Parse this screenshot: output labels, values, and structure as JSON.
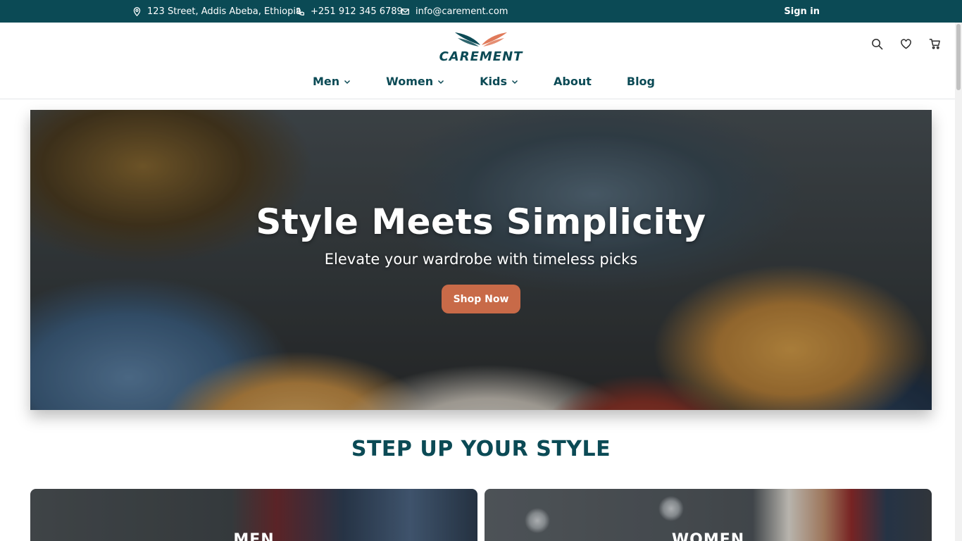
{
  "topbar": {
    "address": "123 Street, Addis Abeba, Ethiopia",
    "phone": "+251 912 345 6789",
    "email": "info@carement.com",
    "signin_label": "Sign in"
  },
  "brand": {
    "name": "CAREMENT",
    "colors": {
      "primary": "#0b4a55",
      "accent": "#c86a48"
    }
  },
  "header_icons": [
    "search-icon",
    "heart-icon",
    "cart-icon"
  ],
  "nav": {
    "items": [
      {
        "label": "Men",
        "has_dropdown": true
      },
      {
        "label": "Women",
        "has_dropdown": true
      },
      {
        "label": "Kids",
        "has_dropdown": true
      },
      {
        "label": "About",
        "has_dropdown": false
      },
      {
        "label": "Blog",
        "has_dropdown": false
      }
    ]
  },
  "hero": {
    "title": "Style Meets Simplicity",
    "subtitle": "Elevate your wardrobe with timeless picks",
    "cta_label": "Shop Now"
  },
  "section": {
    "title": "STEP UP YOUR STYLE"
  },
  "categories": [
    {
      "label": "MEN"
    },
    {
      "label": "WOMEN"
    }
  ]
}
